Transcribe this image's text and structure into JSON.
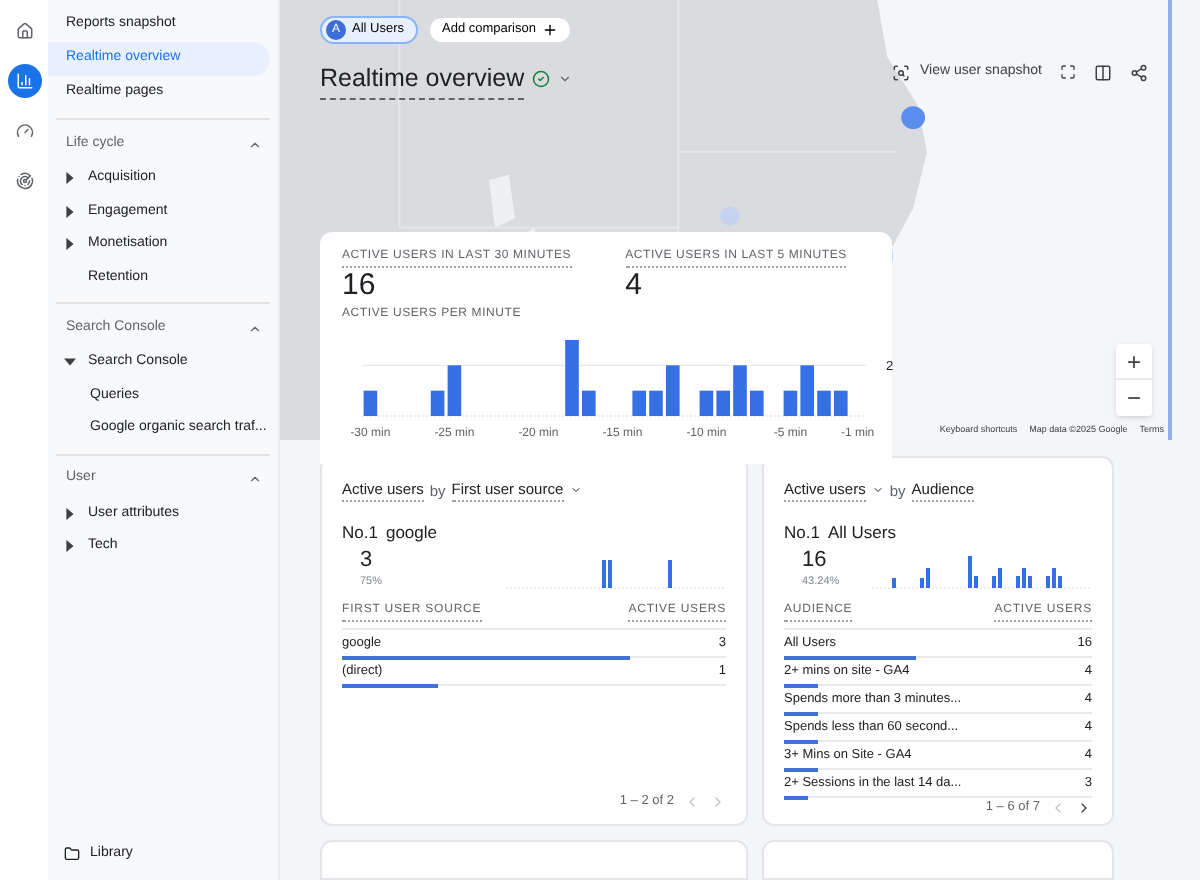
{
  "rail": [
    {
      "kind": "home",
      "selected": false
    },
    {
      "kind": "reports",
      "selected": true
    },
    {
      "kind": "explore",
      "selected": false
    },
    {
      "kind": "advertising",
      "selected": false
    }
  ],
  "nav": {
    "top_items": [
      {
        "label": "Reports snapshot",
        "selected": false
      },
      {
        "label": "Realtime overview",
        "selected": true
      },
      {
        "label": "Realtime pages",
        "selected": false
      }
    ],
    "sections": [
      {
        "title": "Life cycle",
        "expanded": true,
        "items": [
          {
            "label": "Acquisition",
            "kind": "group",
            "expanded": false
          },
          {
            "label": "Engagement",
            "kind": "group",
            "expanded": false
          },
          {
            "label": "Monetisation",
            "kind": "group",
            "expanded": false
          },
          {
            "label": "Retention",
            "kind": "page"
          }
        ]
      },
      {
        "title": "Search Console",
        "expanded": true,
        "items": [
          {
            "label": "Search Console",
            "kind": "group",
            "expanded": true,
            "children": [
              {
                "label": "Queries"
              },
              {
                "label": "Google organic search traf..."
              }
            ]
          }
        ]
      },
      {
        "title": "User",
        "expanded": true,
        "items": [
          {
            "label": "User attributes",
            "kind": "group",
            "expanded": false
          },
          {
            "label": "Tech",
            "kind": "group",
            "expanded": false
          }
        ]
      }
    ],
    "footer": "Library"
  },
  "header": {
    "comparisons": [
      {
        "avatar": "A",
        "label": "All Users"
      }
    ],
    "add_comparison": "Add comparison",
    "title": "Realtime overview",
    "snapshot_button": "View user snapshot"
  },
  "map": {
    "kind": "picture",
    "zoom_in": "+",
    "zoom_out": "−",
    "attribution": [
      "Keyboard shortcuts",
      "Map data ©2025 Google",
      "Terms"
    ]
  },
  "summary": {
    "metrics": [
      {
        "label": "ACTIVE USERS IN LAST 30 MINUTES",
        "value": "16"
      },
      {
        "label": "ACTIVE USERS IN LAST 5 MINUTES",
        "value": "4"
      }
    ],
    "chart_data": {
      "type": "bar",
      "title": "ACTIVE USERS PER MINUTE",
      "x": [
        -30,
        -26,
        -25,
        -18,
        -17,
        -14,
        -13,
        -12,
        -10,
        -9,
        -8,
        -7,
        -5,
        -4,
        -3,
        -2
      ],
      "values": [
        1,
        1,
        2,
        3,
        1,
        1,
        1,
        2,
        1,
        1,
        2,
        1,
        1,
        2,
        1,
        1
      ],
      "ylim": [
        0,
        3
      ],
      "xlim": [
        -30.5,
        -0.5
      ],
      "xticks": [
        {
          "value": -30,
          "label": "-30 min"
        },
        {
          "value": -25,
          "label": "-25 min"
        },
        {
          "value": -20,
          "label": "-20 min"
        },
        {
          "value": -15,
          "label": "-15 min"
        },
        {
          "value": -10,
          "label": "-10 min"
        },
        {
          "value": -5,
          "label": "-5 min"
        },
        {
          "value": -1,
          "label": "-1 min"
        }
      ],
      "yticks": [
        2
      ]
    }
  },
  "cards": [
    {
      "metric": "Active users",
      "metric_dropdown": false,
      "connector": "by",
      "dimension": "First user source",
      "dimension_dropdown": true,
      "top_label": "No.1",
      "top_name": "google",
      "top_value": "3",
      "top_share": "75%",
      "columns": [
        "FIRST USER SOURCE",
        "ACTIVE USERS"
      ],
      "rows": [
        {
          "name": "google",
          "value": "3",
          "level": 0.75
        },
        {
          "name": "(direct)",
          "value": "1",
          "level": 0.25
        }
      ],
      "pagination": "1 – 2 of 2",
      "prev_disabled": true,
      "next_disabled": true
    },
    {
      "metric": "Active users",
      "metric_dropdown": true,
      "connector": "by",
      "dimension": "Audience",
      "dimension_dropdown": false,
      "top_label": "No.1",
      "top_name": "All Users",
      "top_value": "16",
      "top_share": "43.24%",
      "columns": [
        "AUDIENCE",
        "ACTIVE USERS"
      ],
      "rows": [
        {
          "name": "All Users",
          "value": "16",
          "level": 0.43
        },
        {
          "name": "2+ mins on site - GA4",
          "value": "4",
          "level": 0.11
        },
        {
          "name": "Spends more than 3 minutes...",
          "value": "4",
          "level": 0.11
        },
        {
          "name": "Spends less than 60 second...",
          "value": "4",
          "level": 0.11
        },
        {
          "name": "3+ Mins on Site - GA4",
          "value": "4",
          "level": 0.11
        },
        {
          "name": "2+ Sessions in the last 14 da...",
          "value": "3",
          "level": 0.08
        }
      ],
      "pagination": "1 – 6 of 7",
      "prev_disabled": true,
      "next_disabled": false
    }
  ]
}
